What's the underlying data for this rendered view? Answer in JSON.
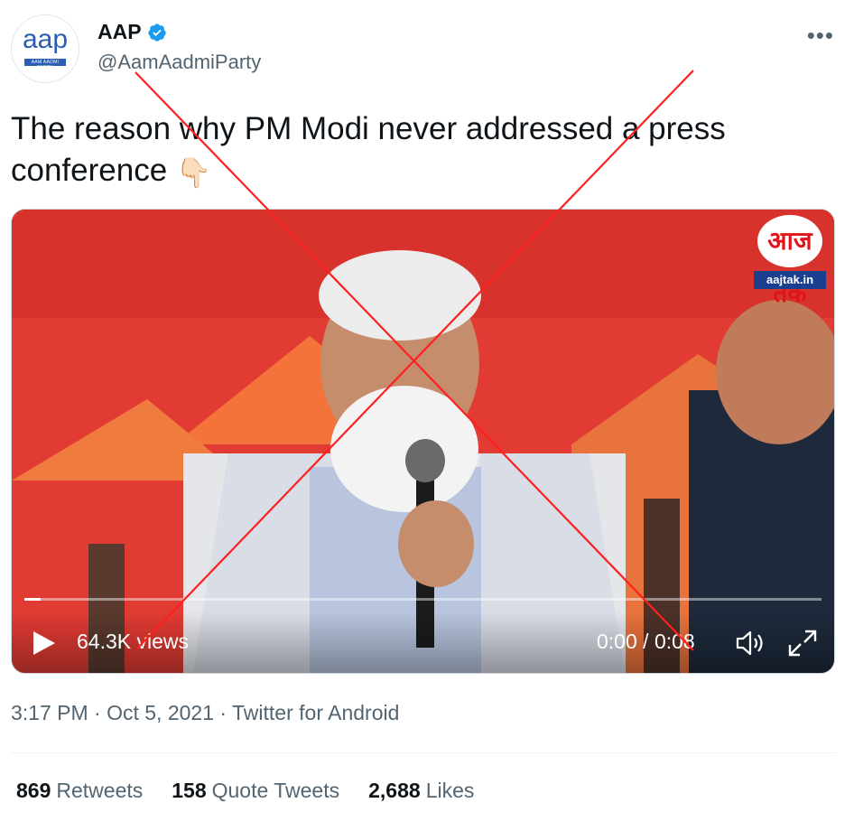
{
  "account": {
    "avatar_text": "aap",
    "avatar_sub": "AAM AADMI PARTY",
    "display_name": "AAP",
    "handle": "@AamAadmiParty"
  },
  "more_label": "•••",
  "tweet": {
    "text": "The reason why PM Modi never addressed a press conference",
    "emoji": "👇🏻"
  },
  "video": {
    "channel_mark": "आज तक",
    "channel_url": "aajtak.in",
    "views": "64.3K views",
    "current_time": "0:00",
    "separator": " / ",
    "duration": "0:08",
    "progress_fraction": 0.02
  },
  "meta": "3:17 PM · Oct 5, 2021 · Twitter for Android",
  "stats": [
    {
      "value": "869",
      "label": "Retweets"
    },
    {
      "value": "158",
      "label": "Quote Tweets"
    },
    {
      "value": "2,688",
      "label": "Likes"
    }
  ],
  "colors": {
    "brand_blue": "#2a5eb5",
    "verified": "#1d9bf0",
    "overlay_x": "#ff1f1f",
    "video_bg": "#e43a34"
  }
}
